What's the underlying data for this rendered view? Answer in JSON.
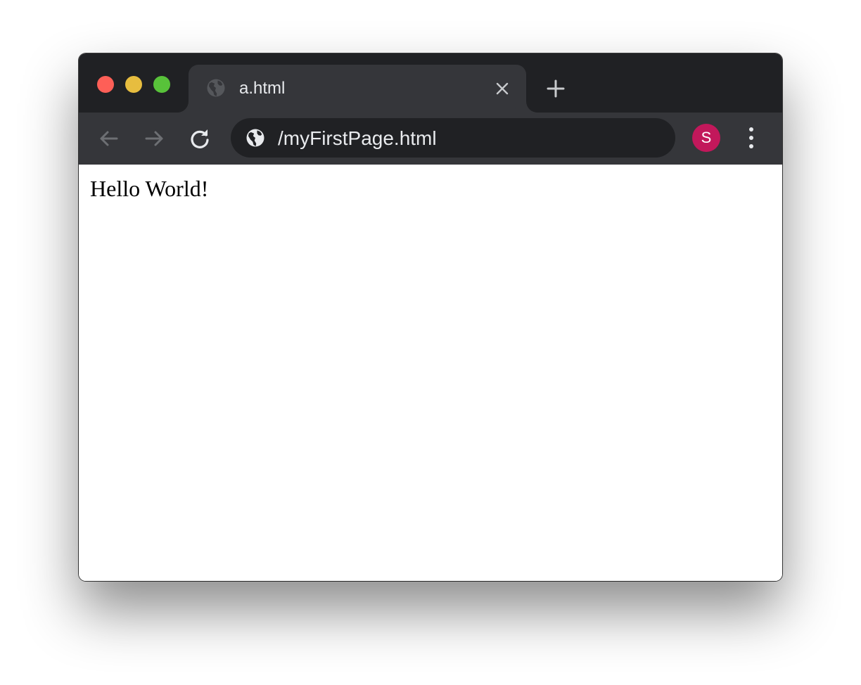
{
  "colors": {
    "tabstrip": "#202124",
    "toolbar": "#35363a",
    "omnibox": "#202124",
    "text": "#e8eaed",
    "icon": "#c8cacd",
    "icon_disabled": "#6d6f73",
    "avatar": "#c2185b",
    "traffic_close": "#fe5f57",
    "traffic_minimize": "#e7bd3f",
    "traffic_maximize": "#58c23a"
  },
  "window_controls": {
    "icons": [
      "close-traffic-light",
      "minimize-traffic-light",
      "maximize-traffic-light"
    ]
  },
  "tab": {
    "favicon": "globe-icon",
    "title": "a.html",
    "close_icon": "close-icon"
  },
  "new_tab": {
    "icon": "plus-icon"
  },
  "toolbar": {
    "back_icon": "arrow-left-icon",
    "forward_icon": "arrow-right-icon",
    "reload_icon": "reload-icon",
    "menu_icon": "more-vertical-icon"
  },
  "address_bar": {
    "icon": "globe-icon",
    "url": "/myFirstPage.html"
  },
  "profile": {
    "initial": "S"
  },
  "page": {
    "text": "Hello World!"
  }
}
